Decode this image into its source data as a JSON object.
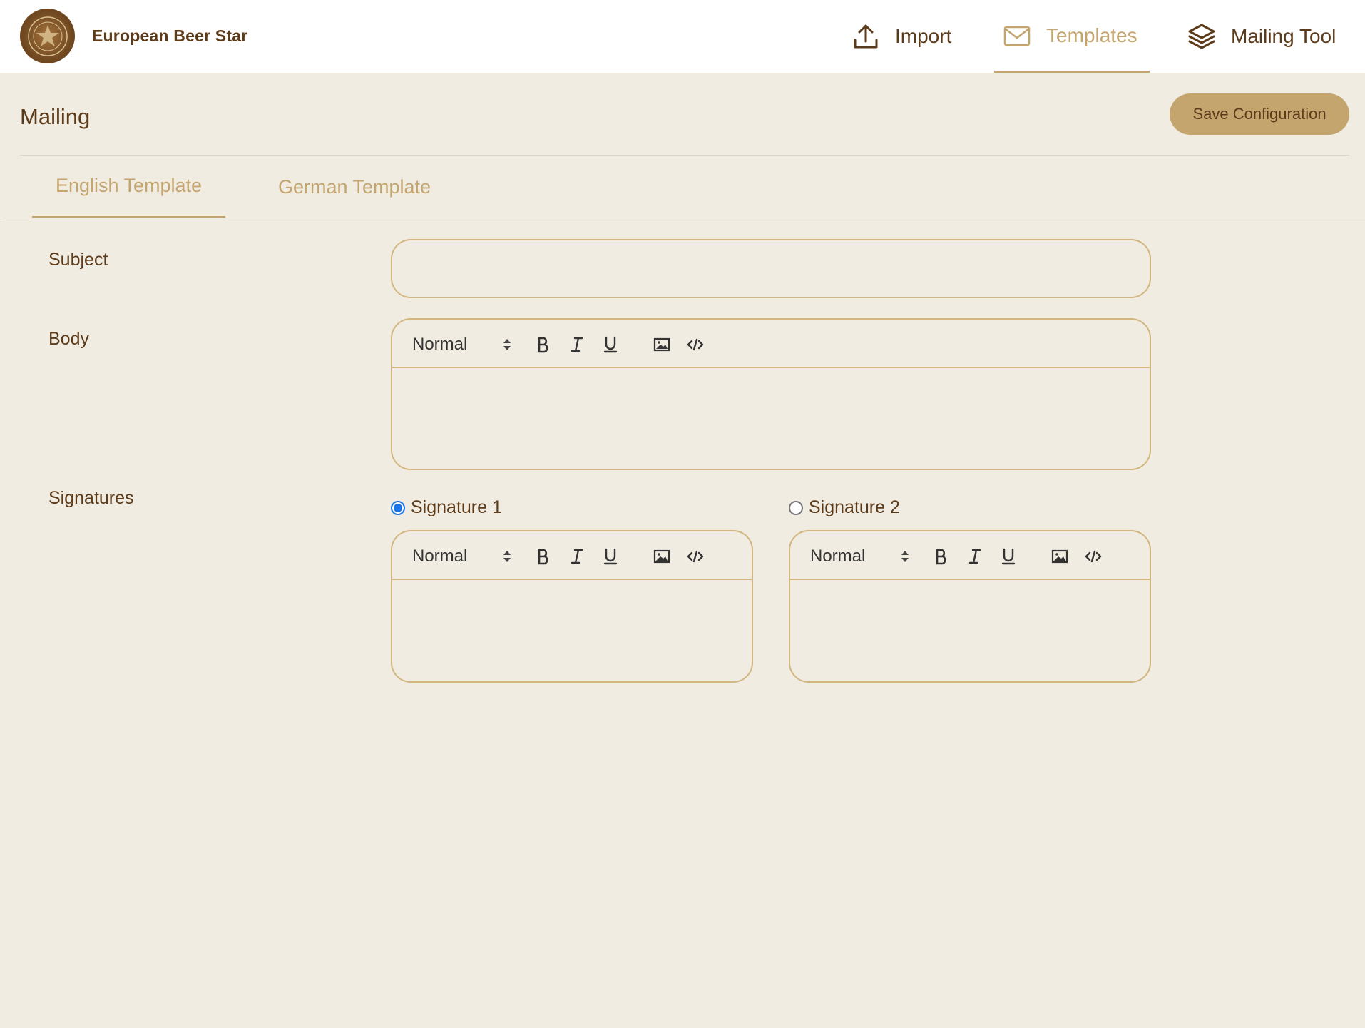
{
  "header": {
    "brand": "European Beer Star",
    "nav": {
      "import": "Import",
      "templates": "Templates",
      "mailing_tool": "Mailing Tool"
    },
    "active_nav": "templates"
  },
  "page": {
    "title": "Mailing",
    "save_label": "Save Configuration"
  },
  "tabs": {
    "english": "English Template",
    "german": "German Template",
    "active": "english"
  },
  "form": {
    "subject_label": "Subject",
    "subject_value": "",
    "body_label": "Body",
    "signatures_label": "Signatures",
    "signature1_label": "Signature 1",
    "signature2_label": "Signature 2",
    "selected_signature": "signature1",
    "format_option": "Normal"
  },
  "colors": {
    "accent": "#c4a56e",
    "text": "#5c3b1a",
    "background": "#f1ece2",
    "radio_checked": "#1a73e8"
  }
}
